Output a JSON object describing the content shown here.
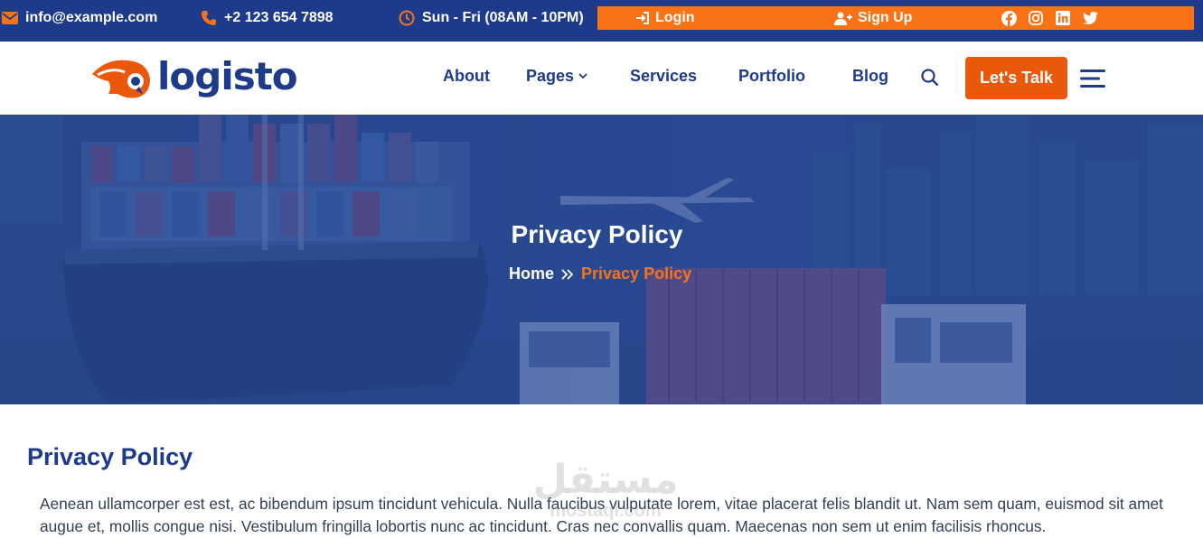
{
  "topbar": {
    "email": "info@example.com",
    "phone": "+2 123 654 7898",
    "hours": "Sun - Fri (08AM - 10PM)",
    "login_label": "Login",
    "signup_label": "Sign Up",
    "social": [
      "facebook-icon",
      "instagram-icon",
      "linkedin-icon",
      "twitter-icon"
    ],
    "bg_color": "#1e3a8a",
    "accent_color": "#f97316"
  },
  "nav": {
    "logo_text": "logisto",
    "items": [
      {
        "label": "About"
      },
      {
        "label": "Pages",
        "has_dropdown": true
      },
      {
        "label": "Services"
      },
      {
        "label": "Portfolio"
      },
      {
        "label": "Blog"
      }
    ],
    "search_icon": "search-icon",
    "cta_label": "Let's Talk",
    "cta_color": "#ea580c",
    "menu_icon": "hamburger-icon"
  },
  "hero": {
    "title": "Privacy Policy",
    "breadcrumb": {
      "home": "Home",
      "current": "Privacy Policy"
    }
  },
  "content": {
    "heading": "Privacy Policy",
    "paragraph": "Aenean ullamcorper est est, ac bibendum ipsum tincidunt vehicula. Nulla faucibus vulputate lorem, vitae placerat felis blandit ut. Nam sem quam, euismod sit amet augue et, mollis congue nisi. Vestibulum fringilla lobortis nunc ac tincidunt. Cras nec convallis quam. Maecenas non sem ut enim facilisis rhoncus."
  },
  "watermark": {
    "arabic": "مستقل",
    "latin": "mostaql.com"
  }
}
